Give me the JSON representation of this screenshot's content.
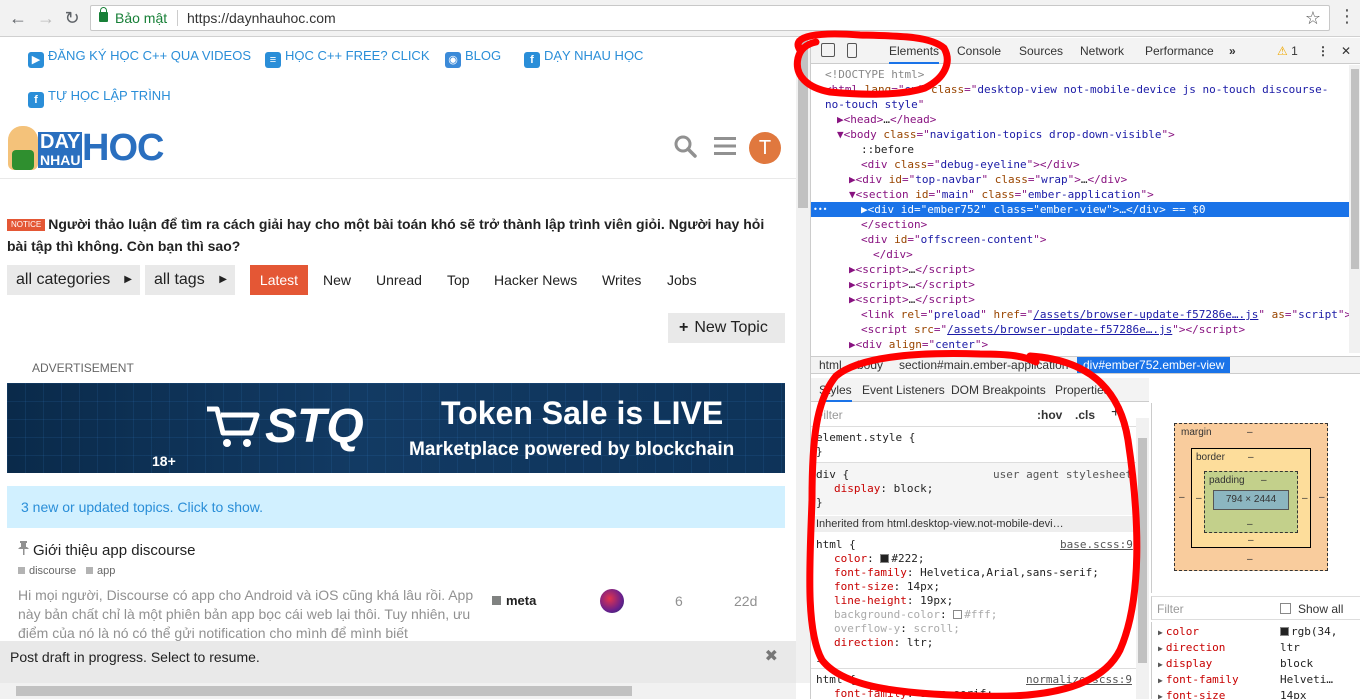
{
  "browser": {
    "secure_label": "Bảo mật",
    "url": "https://daynhauhoc.com"
  },
  "site": {
    "top_links": [
      {
        "label": "ĐĂNG KÝ HỌC C++ QUA VIDEOS",
        "icon": "video-camera-icon"
      },
      {
        "label": "HỌC C++ FREE? CLICK",
        "icon": "book-icon"
      },
      {
        "label": "BLOG",
        "icon": "rss-icon"
      },
      {
        "label": "DẠY NHAU HỌC",
        "icon": "facebook-icon"
      },
      {
        "label": "TỰ HỌC LẬP TRÌNH",
        "icon": "facebook-icon"
      }
    ],
    "logo": {
      "day": "DAY",
      "nhau": "NHAU",
      "hoc": "HOC"
    },
    "avatar_letter": "T",
    "notice_tag": "NOTICE",
    "notice_text": "Người thảo luận để tìm ra cách giải hay cho một bài toán khó sẽ trở thành lập trình viên giỏi. Người hay hỏi bài tập thì không. Còn bạn thì sao?",
    "filters": {
      "categories": "all categories",
      "tags": "all tags"
    },
    "nav_tabs": [
      "Latest",
      "New",
      "Unread",
      "Top",
      "Hacker News",
      "Writes",
      "Jobs"
    ],
    "new_topic": "New Topic",
    "ad_label": "ADVERTISEMENT",
    "ad": {
      "brand": "STQ",
      "headline": "Token Sale is LIVE",
      "sub": "Marketplace powered by blockchain",
      "age": "18+"
    },
    "new_topics_banner": "3 new or updated topics. Click to show.",
    "topic": {
      "title": "Giới thiệu app discourse",
      "tags": [
        "discourse",
        "app"
      ],
      "excerpt": "Hi mọi người, Discourse có app cho Android và iOS cũng khá lâu rồi. App này bản chất chỉ là một phiên bản app bọc cái web lại thôi. Tuy nhiên, ưu điểm của nó là nó có thể gửi notification cho mình để mình biết",
      "category": "meta",
      "replies": "6",
      "activity": "22d"
    },
    "draft": "Post draft in progress. Select to resume."
  },
  "devtools": {
    "tabs": [
      "Elements",
      "Console",
      "Sources",
      "Network",
      "Performance"
    ],
    "more": "»",
    "warnings": "1",
    "dom_lines": [
      {
        "indent": 0,
        "html": "<span class=\"cm\">&lt;!DOCTYPE html&gt;</span>"
      },
      {
        "indent": 0,
        "html": "&lt;html <span class=\"an\">lang</span>=\"<span class=\"av\">en</span>\" <span class=\"an\">class</span>=\"<span class=\"av\">desktop-view not-mobile-device  js no-touch discourse-</span>"
      },
      {
        "indent": 0,
        "html": "<span class=\"av\">no-touch  style</span>\""
      },
      {
        "indent": 1,
        "html": "▶&lt;head&gt;<span class=\"tx\">…</span>&lt;/head&gt;"
      },
      {
        "indent": 1,
        "html": "▼&lt;body <span class=\"an\">class</span>=\"<span class=\"av\">navigation-topics drop-down-visible</span>\"&gt;"
      },
      {
        "indent": 3,
        "html": "<span class=\"tx\">::before</span>"
      },
      {
        "indent": 3,
        "html": "&lt;div <span class=\"an\">class</span>=\"<span class=\"av\">debug-eyeline</span>\"&gt;&lt;/div&gt;"
      },
      {
        "indent": 2,
        "html": "▶&lt;div <span class=\"an\">id</span>=\"<span class=\"av\">top-navbar</span>\" <span class=\"an\">class</span>=\"<span class=\"av\">wrap</span>\"&gt;<span class=\"tx\">…</span>&lt;/div&gt;"
      },
      {
        "indent": 2,
        "html": "▼&lt;section <span class=\"an\">id</span>=\"<span class=\"av\">main</span>\" <span class=\"an\">class</span>=\"<span class=\"av\">ember-application</span>\"&gt;"
      },
      {
        "indent": 3,
        "html": "▶&lt;div <span class=\"an\">id</span>=\"<span class=\"av\">ember752</span>\" <span class=\"an\">class</span>=\"<span class=\"av\">ember-view</span>\"&gt;<span class=\"tx\">…</span>&lt;/div&gt; <span class=\"tx\">== $0</span>",
        "selected": true
      },
      {
        "indent": 3,
        "html": "&lt;/section&gt;"
      },
      {
        "indent": 3,
        "html": "&lt;div <span class=\"an\">id</span>=\"<span class=\"av\">offscreen-content</span>\"&gt;"
      },
      {
        "indent": 4,
        "html": "&lt;/div&gt;"
      },
      {
        "indent": 2,
        "html": "▶&lt;script&gt;<span class=\"tx\">…</span>&lt;/script&gt;"
      },
      {
        "indent": 2,
        "html": "▶&lt;script&gt;<span class=\"tx\">…</span>&lt;/script&gt;"
      },
      {
        "indent": 2,
        "html": "▶&lt;script&gt;<span class=\"tx\">…</span>&lt;/script&gt;"
      },
      {
        "indent": 3,
        "html": "&lt;link <span class=\"an\">rel</span>=\"<span class=\"av\">preload</span>\" <span class=\"an\">href</span>=\"<span class=\"av\"><u>/assets/browser-update-f57286e….js</u></span>\" <span class=\"an\">as</span>=\"<span class=\"av\">script</span>\"&gt;"
      },
      {
        "indent": 3,
        "html": "&lt;script <span class=\"an\">src</span>=\"<span class=\"av\"><u>/assets/browser-update-f57286e….js</u></span>\"&gt;&lt;/script&gt;"
      },
      {
        "indent": 2,
        "html": "▶&lt;div <span class=\"an\">align</span>=\"<span class=\"av\">center</span>\"&gt;"
      }
    ],
    "breadcrumbs": [
      "html",
      "body",
      "section#main.ember-application",
      "div#ember752.ember-view"
    ],
    "styles_tabs": [
      "Styles",
      "Event Listeners",
      "DOM Breakpoints",
      "Properties"
    ],
    "filter_placeholder": "Filter",
    "hov": ":hov",
    "cls": ".cls",
    "rules": {
      "element_style": "element.style {",
      "div_selector": "div {",
      "div_source": "user agent stylesheet",
      "div_prop": "display",
      "div_val": "block;",
      "inherited_label": "Inherited from",
      "inherited_target": "html.desktop-view.not-mobile-devi…",
      "html_selector": "html {",
      "html_source": "base.scss:9",
      "html_props": [
        {
          "prop": "color",
          "val": "#222;",
          "swatch": "#222222"
        },
        {
          "prop": "font-family",
          "val": "Helvetica,Arial,sans-serif;"
        },
        {
          "prop": "font-size",
          "val": "14px;"
        },
        {
          "prop": "line-height",
          "val": "19px;"
        },
        {
          "prop": "background-color",
          "val": "#fff;",
          "swatch": "#ffffff",
          "dim": true
        },
        {
          "prop": "overflow-y",
          "val": "scroll;",
          "dim": true
        },
        {
          "prop": "direction",
          "val": "ltr;"
        }
      ],
      "html2_selector": "html {",
      "html2_source": "normalize.scss:9",
      "html2_prop": "font-family",
      "html2_val": "sans-serif;"
    },
    "box_model": {
      "margin": "margin",
      "border": "border",
      "padding": "padding",
      "content": "794 × 2444",
      "dash": "–"
    },
    "computed_filter": "Filter",
    "show_all": "Show all",
    "computed": [
      {
        "prop": "color",
        "val": "rgb(34,",
        "swatch": "#222222"
      },
      {
        "prop": "direction",
        "val": "ltr"
      },
      {
        "prop": "display",
        "val": "block"
      },
      {
        "prop": "font-family",
        "val": "Helveti…"
      },
      {
        "prop": "font-size",
        "val": "14px"
      }
    ]
  },
  "colors": {
    "accent": "#e45735",
    "link": "#2a8ed8",
    "devtools_select": "#1a73e8",
    "annotation": "#ff0000"
  }
}
